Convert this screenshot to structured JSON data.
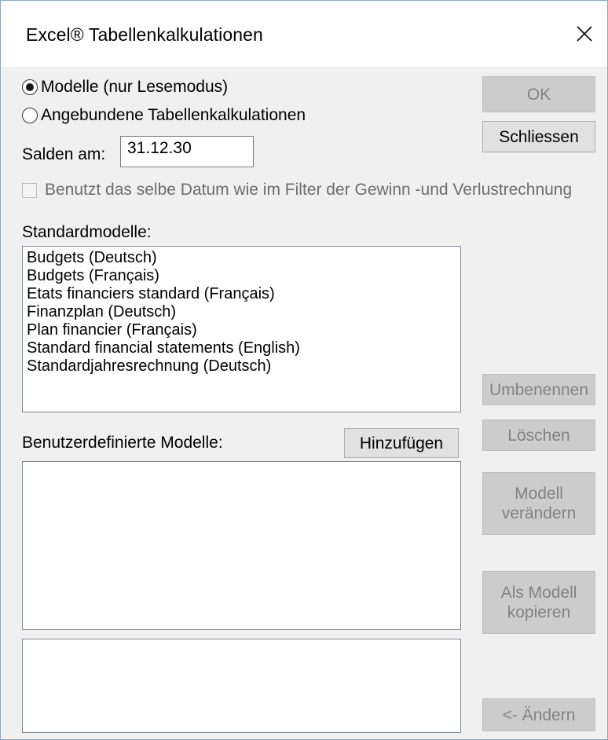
{
  "window": {
    "title": "Excel® Tabellenkalkulationen"
  },
  "icons": {
    "close": "close-icon"
  },
  "options": {
    "radio_models_label": "Modelle (nur Lesemodus)",
    "radio_models_selected": true,
    "radio_linked_label": "Angebundene Tabellenkalkulationen",
    "radio_linked_selected": false,
    "balance_label": "Salden am:",
    "balance_value": "31.12.30",
    "same_date_label": "Benutzt das selbe Datum wie im Filter der Gewinn -und Verlustrechnung",
    "same_date_checked": false
  },
  "standard_models": {
    "label": "Standardmodelle:",
    "items": [
      "Budgets (Deutsch)",
      "Budgets (Français)",
      "Etats financiers standard (Français)",
      "Finanzplan (Deutsch)",
      "Plan financier (Français)",
      "Standard financial statements (English)",
      "Standardjahresrechnung (Deutsch)"
    ]
  },
  "custom_models": {
    "label": "Benutzerdefinierte Modelle:",
    "add_button": "Hinzufügen",
    "items": []
  },
  "buttons": {
    "ok": "OK",
    "close": "Schliessen",
    "rename": "Umbenennen",
    "delete": "Löschen",
    "modify_model_line1": "Modell",
    "modify_model_line2": "verändern",
    "copy_as_model_line1": "Als Modell",
    "copy_as_model_line2": "kopieren",
    "change": "<- Ändern"
  }
}
